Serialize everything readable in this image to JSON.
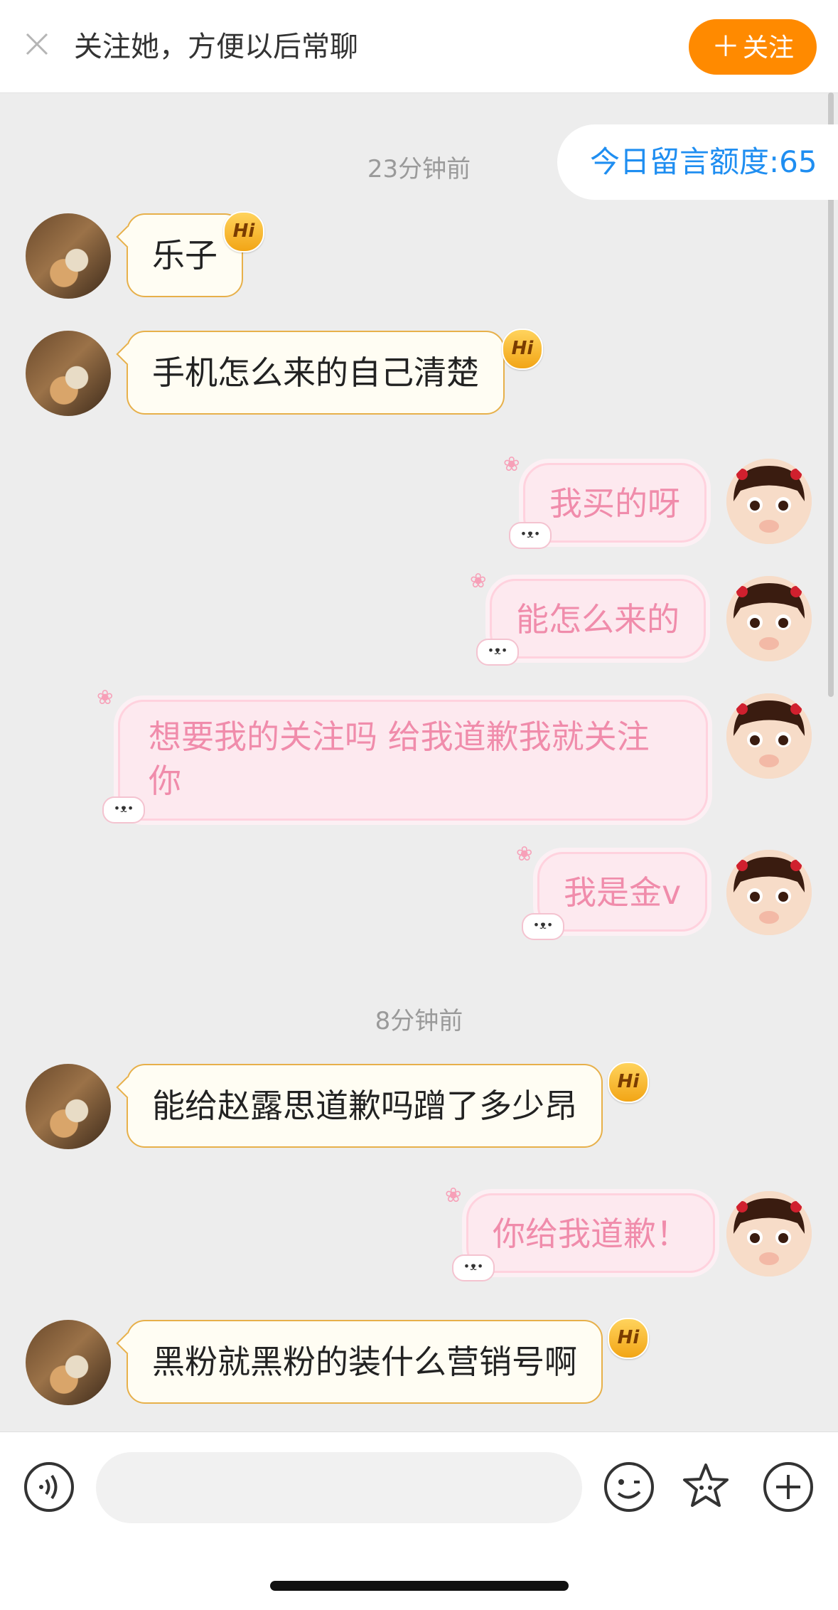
{
  "header": {
    "title": "关注她，方便以后常聊",
    "follow_label": "关注",
    "follow_plus": "＋"
  },
  "quota": {
    "label": "今日留言额度:65"
  },
  "timestamps": [
    "23分钟前",
    "8分钟前"
  ],
  "hi_badge": "Hi",
  "messages": [
    {
      "side": "left",
      "text": "乐子"
    },
    {
      "side": "left",
      "text": "手机怎么来的自己清楚"
    },
    {
      "side": "right",
      "text": "我买的呀"
    },
    {
      "side": "right",
      "text": "能怎么来的"
    },
    {
      "side": "right",
      "text": "想要我的关注吗 给我道歉我就关注你"
    },
    {
      "side": "right",
      "text": "我是金v"
    },
    {
      "side": "left",
      "text": "能给赵露思道歉吗蹭了多少昂"
    },
    {
      "side": "right",
      "text": "你给我道歉！"
    },
    {
      "side": "left",
      "text": "黑粉就黑粉的装什么营销号啊"
    }
  ],
  "icons": {
    "close": "close-icon",
    "voice": "voice-icon",
    "emoji": "emoji-icon",
    "sticker": "star-sticker-icon",
    "add": "plus-circle-icon"
  },
  "colors": {
    "follow": "#ff8a00",
    "quota_text": "#1f8ef1",
    "left_bubble_border": "#e7b04a",
    "right_bubble_text": "#f08cab"
  }
}
